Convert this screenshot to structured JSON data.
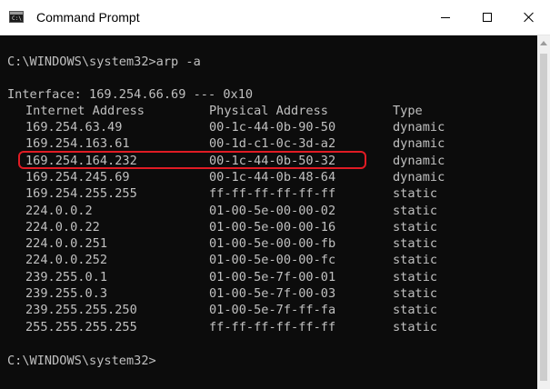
{
  "window": {
    "title": "Command Prompt"
  },
  "console": {
    "command_line": "C:\\WINDOWS\\system32>arp -a",
    "interface_line": "Interface: 169.254.66.69 --- 0x10",
    "headers": {
      "ip": "Internet Address",
      "mac": "Physical Address",
      "type": "Type"
    },
    "rows": [
      {
        "ip": "169.254.63.49",
        "mac": "00-1c-44-0b-90-50",
        "type": "dynamic"
      },
      {
        "ip": "169.254.163.61",
        "mac": "00-1d-c1-0c-3d-a2",
        "type": "dynamic"
      },
      {
        "ip": "169.254.164.232",
        "mac": "00-1c-44-0b-50-32",
        "type": "dynamic"
      },
      {
        "ip": "169.254.245.69",
        "mac": "00-1c-44-0b-48-64",
        "type": "dynamic"
      },
      {
        "ip": "169.254.255.255",
        "mac": "ff-ff-ff-ff-ff-ff",
        "type": "static"
      },
      {
        "ip": "224.0.0.2",
        "mac": "01-00-5e-00-00-02",
        "type": "static"
      },
      {
        "ip": "224.0.0.22",
        "mac": "01-00-5e-00-00-16",
        "type": "static"
      },
      {
        "ip": "224.0.0.251",
        "mac": "01-00-5e-00-00-fb",
        "type": "static"
      },
      {
        "ip": "224.0.0.252",
        "mac": "01-00-5e-00-00-fc",
        "type": "static"
      },
      {
        "ip": "239.255.0.1",
        "mac": "01-00-5e-7f-00-01",
        "type": "static"
      },
      {
        "ip": "239.255.0.3",
        "mac": "01-00-5e-7f-00-03",
        "type": "static"
      },
      {
        "ip": "239.255.255.250",
        "mac": "01-00-5e-7f-ff-fa",
        "type": "static"
      },
      {
        "ip": "255.255.255.255",
        "mac": "ff-ff-ff-ff-ff-ff",
        "type": "static"
      }
    ],
    "highlighted_row": 2,
    "prompt_line": "C:\\WINDOWS\\system32>"
  },
  "colors": {
    "console_bg": "#0c0c0c",
    "console_text": "#c0c0c0",
    "highlight": "#e01b24"
  },
  "icons": {
    "app": "command-prompt-icon",
    "minimize": "minimize-icon",
    "maximize": "maximize-icon",
    "close": "close-icon"
  }
}
